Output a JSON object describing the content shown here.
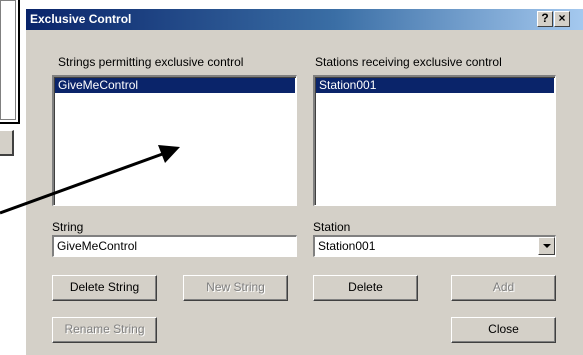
{
  "dialog": {
    "title": "Exclusive Control",
    "help_glyph": "?",
    "close_glyph": "×"
  },
  "strings_panel": {
    "label": "Strings permitting exclusive control",
    "items": [
      "GiveMeControl"
    ],
    "selected": "GiveMeControl"
  },
  "stations_panel": {
    "label": "Stations receiving exclusive control",
    "items": [
      "Station001"
    ],
    "selected": "Station001"
  },
  "string_field": {
    "label": "String",
    "value": "GiveMeControl"
  },
  "station_field": {
    "label": "Station",
    "value": "Station001"
  },
  "buttons": {
    "delete_string": "Delete String",
    "new_string": "New String",
    "delete": "Delete",
    "add": "Add",
    "rename_string": "Rename String",
    "close": "Close"
  },
  "colors": {
    "face": "#d4d0c8",
    "selection": "#0a246a",
    "title_start": "#0a246a",
    "title_end": "#a6caf0",
    "disabled_text": "#808080"
  },
  "icons": {
    "arrow": "annotation-arrow-icon",
    "combo": "chevron-down-icon"
  }
}
